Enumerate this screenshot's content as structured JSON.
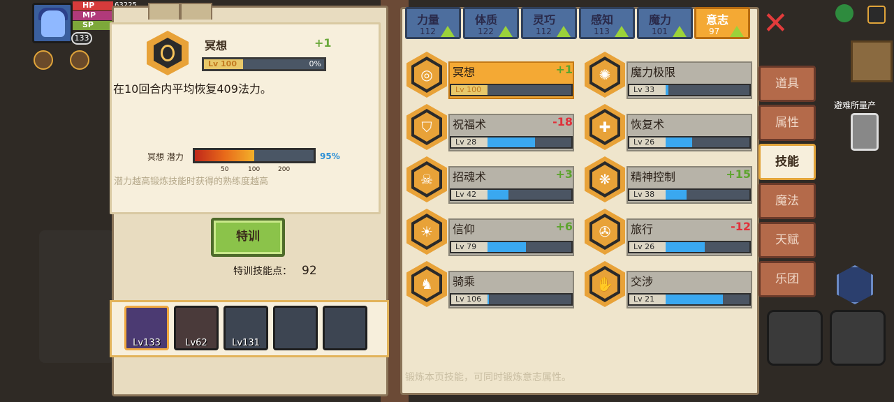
{
  "hud": {
    "hp_label": "HP",
    "mp_label": "MP",
    "sp_label": "SP",
    "hp_value": "63225",
    "level": "133"
  },
  "detail": {
    "skill_name": "冥想",
    "skill_change": "+1",
    "level_tag": "Lv 100",
    "progress_pct": "0%",
    "description": "在10回合内平均恢复409法力。",
    "potential_label": "冥想 潜力",
    "potential_pct": "95%",
    "potential_value": 0.5,
    "potential_ticks": [
      "50",
      "100",
      "200"
    ],
    "hint": "潜力越高锻炼技能时获得的熟练度越高",
    "train_button": "特训",
    "train_points_label": "特训技能点：",
    "train_points_value": "92"
  },
  "party": [
    {
      "level": "Lv133",
      "selected": true
    },
    {
      "level": "Lv62",
      "selected": false
    },
    {
      "level": "Lv131",
      "selected": false
    },
    {
      "level": "",
      "selected": false
    },
    {
      "level": "",
      "selected": false
    }
  ],
  "attributes": [
    {
      "name": "力量",
      "value": "112",
      "active": false
    },
    {
      "name": "体质",
      "value": "122",
      "active": false
    },
    {
      "name": "灵巧",
      "value": "112",
      "active": false
    },
    {
      "name": "感知",
      "value": "113",
      "active": false
    },
    {
      "name": "魔力",
      "value": "101",
      "active": false
    },
    {
      "name": "意志",
      "value": "97",
      "active": true
    }
  ],
  "skills": [
    {
      "name": "冥想",
      "change": "+1",
      "level": "Lv 100",
      "progress": 0,
      "selected": true,
      "icon": "meditation-icon"
    },
    {
      "name": "魔力极限",
      "change": "",
      "level": "Lv 33",
      "progress": 0.03,
      "selected": false,
      "icon": "mana-limit-icon"
    },
    {
      "name": "祝福术",
      "change": "-18",
      "level": "Lv 28",
      "progress": 0.57,
      "selected": false,
      "icon": "blessing-icon"
    },
    {
      "name": "恢复术",
      "change": "",
      "level": "Lv 26",
      "progress": 0.32,
      "selected": false,
      "icon": "healing-icon"
    },
    {
      "name": "招魂术",
      "change": "+3",
      "level": "Lv 42",
      "progress": 0.25,
      "selected": false,
      "icon": "necromancy-icon"
    },
    {
      "name": "精神控制",
      "change": "+15",
      "level": "Lv 38",
      "progress": 0.25,
      "selected": false,
      "icon": "mind-control-icon"
    },
    {
      "name": "信仰",
      "change": "+6",
      "level": "Lv 79",
      "progress": 0.46,
      "selected": false,
      "icon": "faith-icon"
    },
    {
      "name": "旅行",
      "change": "-12",
      "level": "Lv 26",
      "progress": 0.47,
      "selected": false,
      "icon": "travel-icon"
    },
    {
      "name": "骑乘",
      "change": "",
      "level": "Lv 106",
      "progress": 0.02,
      "selected": false,
      "icon": "riding-icon"
    },
    {
      "name": "交涉",
      "change": "",
      "level": "Lv 21",
      "progress": 0.68,
      "selected": false,
      "icon": "negotiation-icon"
    }
  ],
  "footnote": "锻炼本页技能，可同时锻炼意志属性。",
  "menu": [
    {
      "label": "道具",
      "active": false
    },
    {
      "label": "属性",
      "active": false
    },
    {
      "label": "技能",
      "active": true
    },
    {
      "label": "魔法",
      "active": false
    },
    {
      "label": "天赋",
      "active": false
    },
    {
      "label": "乐团",
      "active": false
    }
  ],
  "refuge_label": "避难所量产",
  "colors": {
    "accent": "#f4a934",
    "positive": "#5da42e",
    "negative": "#e0303a",
    "progress": "#3aa8f0"
  }
}
